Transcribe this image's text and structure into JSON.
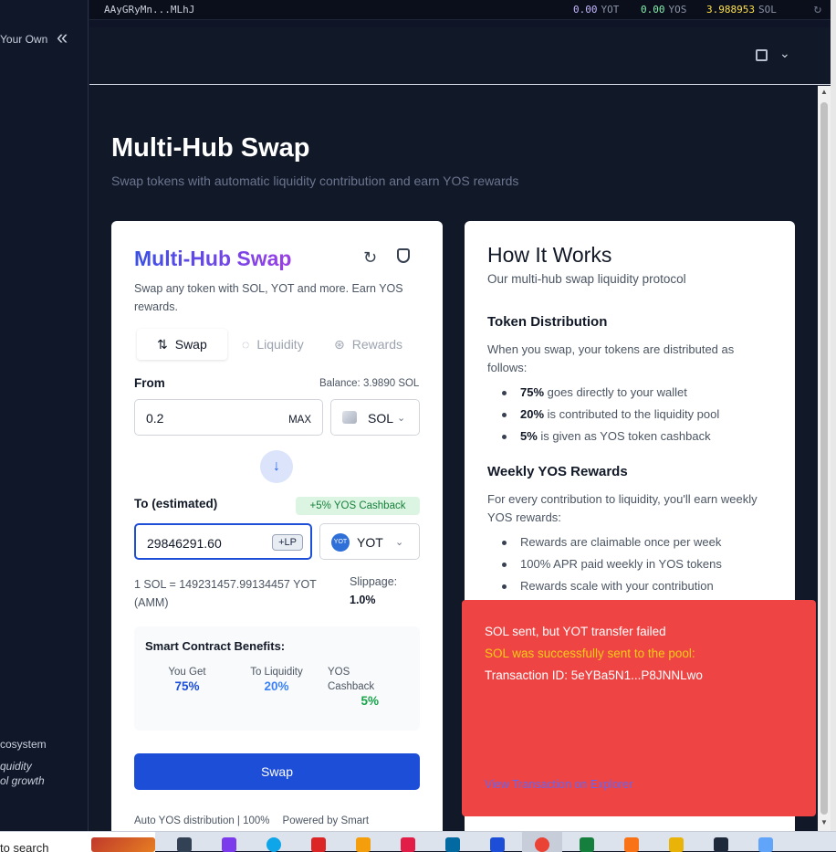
{
  "sidebar": {
    "brand_fragment": "Your Own",
    "collapse_icon": "«",
    "ecosystem_fragment": "cosystem",
    "liquidity_fragment": "quidity",
    "growth_fragment": "ol growth"
  },
  "topbar": {
    "wallet_address": "AAyGRyMn...MLhJ",
    "balances": [
      {
        "value": "0.00",
        "unit": "YOT",
        "color": "#c4b5fd"
      },
      {
        "value": "0.00",
        "unit": "YOS",
        "color": "#86efac"
      },
      {
        "value": "3.988953",
        "unit": "SOL",
        "color": "#fde047"
      }
    ],
    "refresh_icon": "↻"
  },
  "page": {
    "title": "Multi-Hub Swap",
    "subtitle": "Swap tokens with automatic liquidity contribution and earn YOS rewards"
  },
  "swap_card": {
    "title": "Multi-Hub Swap",
    "description": "Swap any token with SOL, YOT and more. Earn YOS rewards.",
    "tabs": [
      {
        "label": "Swap",
        "icon": "⇅"
      },
      {
        "label": "Liquidity",
        "icon": "◌"
      },
      {
        "label": "Rewards",
        "icon": "⊛"
      }
    ],
    "from_label": "From",
    "balance": "Balance: 3.9890 SOL",
    "from_value": "0.2",
    "max_label": "MAX",
    "from_token": "SOL",
    "arrow_icon": "↓",
    "to_label": "To (estimated)",
    "cashback_badge": "+5% YOS Cashback",
    "to_value": "29846291.60",
    "lp_badge": "+LP",
    "to_token": "YOT",
    "yot_icon_text": "YOT",
    "rate": "1 SOL = 149231457.99134457 YOT (AMM)",
    "slippage_label": "Slippage:",
    "slippage_value": "1.0%",
    "benefits_title": "Smart Contract Benefits:",
    "benefits": [
      {
        "label": "You Get",
        "value": "75%",
        "color": "#1d4ed8"
      },
      {
        "label": "To Liquidity",
        "value": "20%",
        "color": "#3b82f6"
      },
      {
        "label": "YOS Cashback",
        "value": "5%",
        "color": "#16a34a"
      }
    ],
    "swap_button": "Swap",
    "footer_a": "Auto YOS distribution | 100%",
    "footer_b": "Powered by Smart"
  },
  "how_it_works": {
    "title": "How It Works",
    "subtitle": "Our multi-hub swap liquidity protocol",
    "dist_heading": "Token Distribution",
    "dist_text": "When you swap, your tokens are distributed as follows:",
    "dist_items": [
      {
        "bold": "75%",
        "text": " goes directly to your wallet"
      },
      {
        "bold": "20%",
        "text": " is contributed to the liquidity pool"
      },
      {
        "bold": "5%",
        "text": " is given as YOS token cashback"
      }
    ],
    "rewards_heading": "Weekly YOS Rewards",
    "rewards_text": "For every contribution to liquidity, you'll earn weekly YOS rewards:",
    "rewards_items": [
      "Rewards are claimable once per week",
      "100% APR paid weekly in YOS tokens",
      "Rewards scale with your contribution"
    ]
  },
  "toast": {
    "title": "SOL sent, but YOT transfer failed",
    "subtitle": "SOL was successfully sent to the pool:",
    "tx": "Transaction ID: 5eYBa5N1...P8JNNLwo",
    "link": "View Transaction on Explorer"
  },
  "taskbar": {
    "search_fragment": "to search"
  }
}
